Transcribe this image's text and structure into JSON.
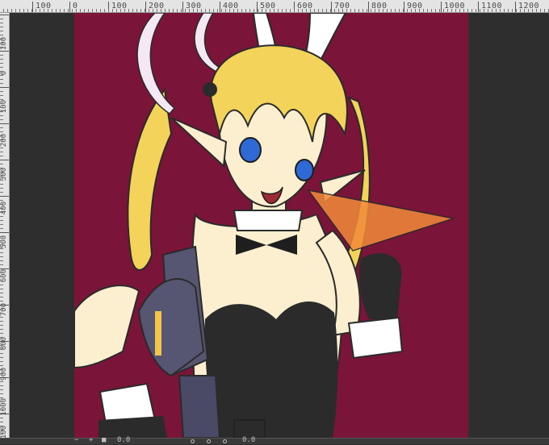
{
  "ruler_top": {
    "labels": [
      "100",
      "0",
      "100",
      "200",
      "300",
      "400",
      "500",
      "600",
      "700",
      "800",
      "900",
      "1000",
      "1100",
      "1200"
    ]
  },
  "ruler_left": {
    "labels": [
      "100",
      "0",
      "100",
      "200",
      "300",
      "400",
      "500",
      "600",
      "700",
      "800",
      "900",
      "1000",
      "1100"
    ]
  },
  "bottom_bar": {
    "zoom_minus": "−",
    "zoom_plus": "+",
    "zoom_value": "0.0",
    "rotate_value": "0.0"
  },
  "colors": {
    "canvas_background": "#7a1438",
    "workspace": "#2e2e2e",
    "ruler": "#e4e4e4",
    "hair": "#f3d35a",
    "skin": "#fbefcf",
    "suit": "#2b2b2b",
    "eyes": "#2e69d6",
    "carrot": "#f28a3a",
    "gun": "#565673"
  },
  "icons": {
    "zoom_out": "minus-icon",
    "zoom_in": "plus-icon",
    "fit": "square-icon",
    "rotate_left": "rotate-left-icon",
    "rotate_right": "rotate-right-icon",
    "reset_rotation": "reset-icon"
  }
}
